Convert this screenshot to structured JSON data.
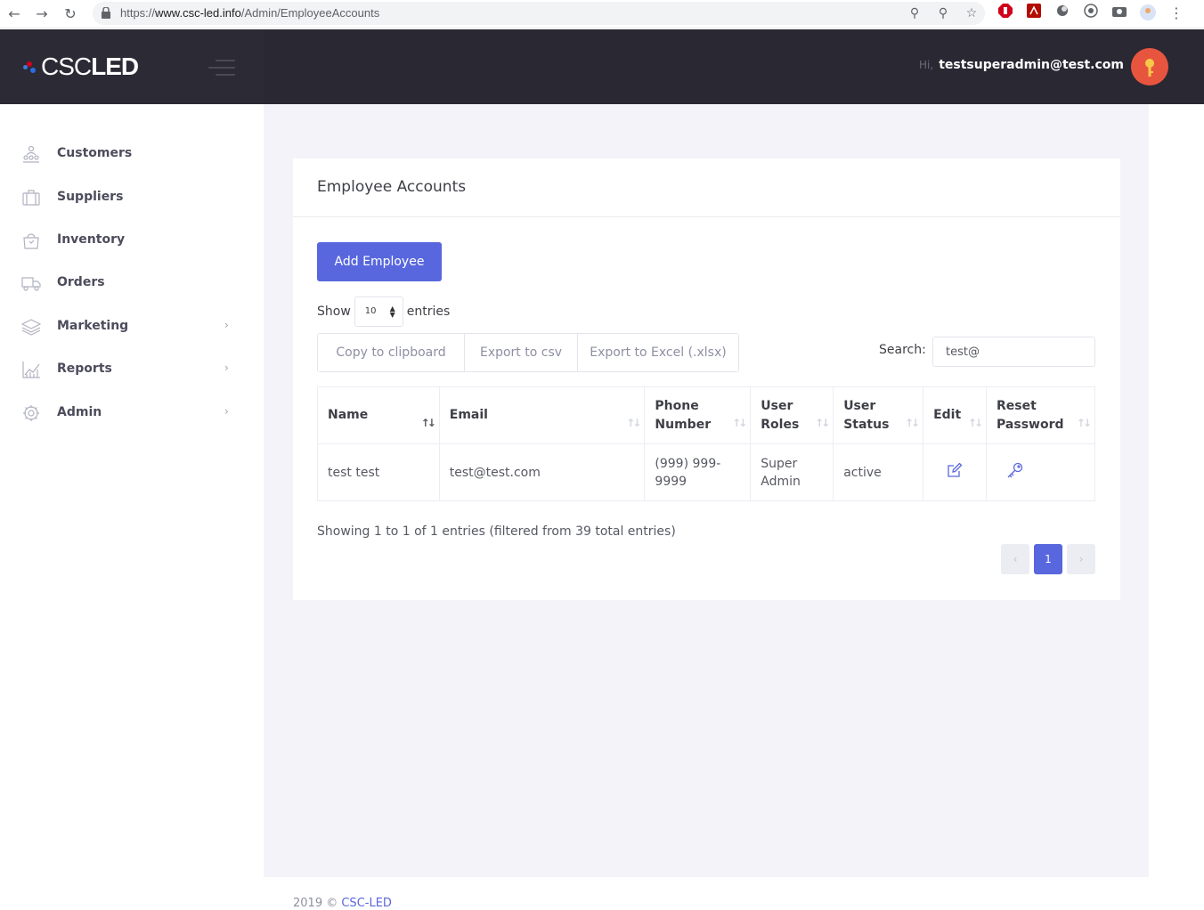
{
  "browser": {
    "url_prefix": "https://",
    "url_domain": "www.csc-led.info",
    "url_path": "/Admin/EmployeeAccounts"
  },
  "brand": {
    "logo_text_1": "CSC",
    "logo_text_2": "LED"
  },
  "header": {
    "greeting": "Hi,",
    "user_email": "testsuperadmin@test.com"
  },
  "sidebar": {
    "items": [
      {
        "label": "Customers",
        "icon": "customers-icon",
        "has_submenu": false
      },
      {
        "label": "Suppliers",
        "icon": "briefcase-icon",
        "has_submenu": false
      },
      {
        "label": "Inventory",
        "icon": "shopping-bag-icon",
        "has_submenu": false
      },
      {
        "label": "Orders",
        "icon": "truck-icon",
        "has_submenu": false
      },
      {
        "label": "Marketing",
        "icon": "layers-icon",
        "has_submenu": true,
        "arrow": "›"
      },
      {
        "label": "Reports",
        "icon": "chart-icon",
        "has_submenu": true,
        "arrow": "›"
      },
      {
        "label": "Admin",
        "icon": "gear-icon",
        "has_submenu": true,
        "arrow": "›"
      }
    ]
  },
  "page": {
    "title": "Employee Accounts",
    "add_button": "Add Employee",
    "show_label": "Show",
    "entries_label": "entries",
    "page_length": "10",
    "export_buttons": [
      "Copy to clipboard",
      "Export to csv",
      "Export to Excel (.xlsx)"
    ],
    "search_label": "Search:",
    "search_value": "test@"
  },
  "table": {
    "columns": [
      {
        "l1": "Name",
        "l2": ""
      },
      {
        "l1": "Email",
        "l2": ""
      },
      {
        "l1": "Phone",
        "l2": "Number"
      },
      {
        "l1": "User",
        "l2": "Roles"
      },
      {
        "l1": "User",
        "l2": "Status"
      },
      {
        "l1": "Edit",
        "l2": ""
      },
      {
        "l1": "Reset",
        "l2": "Password"
      }
    ],
    "rows": [
      {
        "name": "test test",
        "email": "test@test.com",
        "phone_1": "(999) 999-",
        "phone_2": "9999",
        "roles_1": "Super",
        "roles_2": "Admin",
        "status": "active",
        "edit_icon": "edit-icon",
        "reset_icon": "key-icon"
      }
    ]
  },
  "pagination": {
    "info": "Showing 1 to 1 of 1 entries (filtered from 39 total entries)",
    "prev": "‹",
    "current": "1",
    "next": "›"
  },
  "footer": {
    "copyright": "2019 ©",
    "link": "CSC-LED"
  },
  "colors": {
    "accent": "#5867dd",
    "header_dark": "#292833",
    "avatar": "#e8553f",
    "page_bg": "#f3f3f9"
  }
}
